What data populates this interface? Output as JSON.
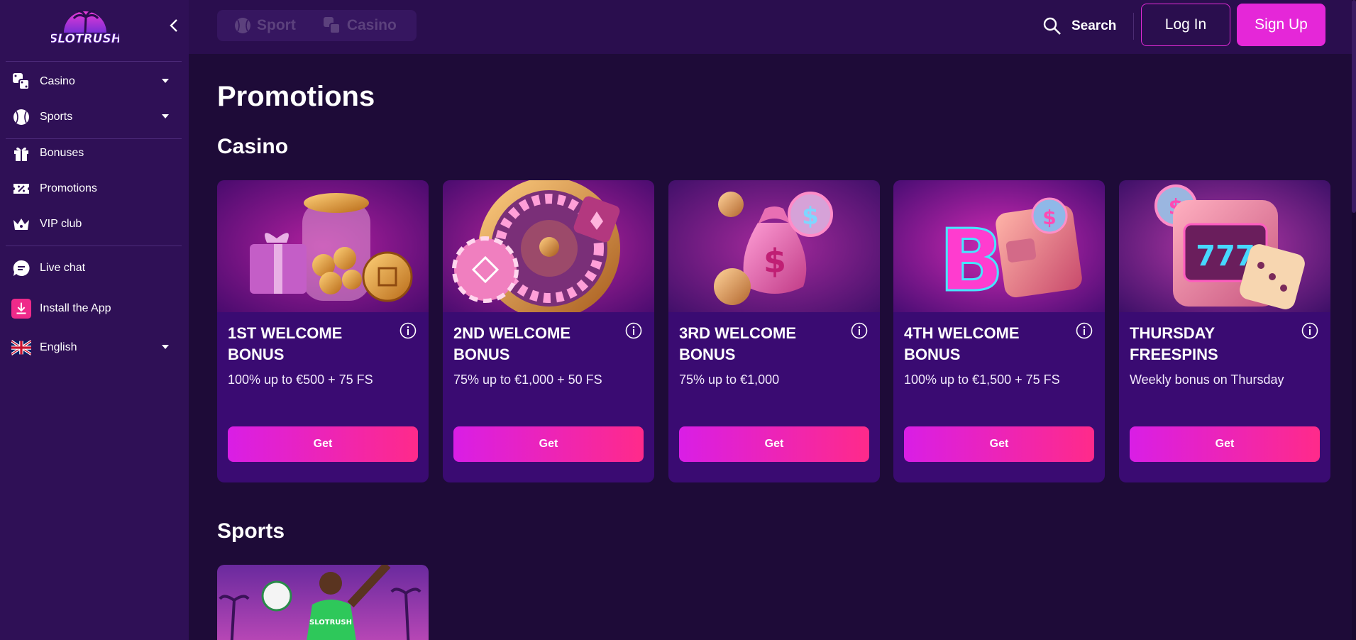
{
  "brand": {
    "logo_text": "SLOTRUSH",
    "accent": "#e527d8"
  },
  "sidebar": {
    "items": [
      {
        "label": "Casino",
        "icon": "dice-icon"
      },
      {
        "label": "Sports",
        "icon": "baseball-icon"
      },
      {
        "label": "Bonuses",
        "icon": "gift-icon"
      },
      {
        "label": "Promotions",
        "icon": "ticket-icon"
      },
      {
        "label": "VIP club",
        "icon": "crown-icon"
      },
      {
        "label": "Live chat",
        "icon": "chat-icon"
      },
      {
        "label": "Install the App",
        "icon": "download-icon"
      },
      {
        "label": "English",
        "icon": "uk-flag-icon"
      }
    ]
  },
  "header": {
    "tabs": [
      {
        "label": "Sport",
        "icon": "baseball-icon"
      },
      {
        "label": "Casino",
        "icon": "dice-icon"
      }
    ],
    "search_label": "Search",
    "login_label": "Log In",
    "signup_label": "Sign Up"
  },
  "main": {
    "title": "Promotions",
    "casino_section_title": "Casino",
    "sports_section_title": "Sports",
    "casino_cards": [
      {
        "title": "1ST WELCOME BONUS",
        "description": "100% up to €500 + 75 FS",
        "button": "Get",
        "image": "gift-coin-jar"
      },
      {
        "title": "2ND WELCOME BONUS",
        "description": "75% up to €1,000 + 50 FS",
        "button": "Get",
        "image": "roulette-wheel"
      },
      {
        "title": "3RD WELCOME BONUS",
        "description": "75% up to €1,000",
        "button": "Get",
        "image": "money-bag"
      },
      {
        "title": "4TH WELCOME BONUS",
        "description": "100% up to €1,500 + 75 FS",
        "button": "Get",
        "image": "bitcoin-wallet"
      },
      {
        "title": "THURSDAY FREESPINS",
        "description": "Weekly bonus on Thursday",
        "button": "Get",
        "image": "slot-machine-777"
      }
    ],
    "sports_cards": [
      {
        "image": "soccer-player"
      }
    ]
  }
}
